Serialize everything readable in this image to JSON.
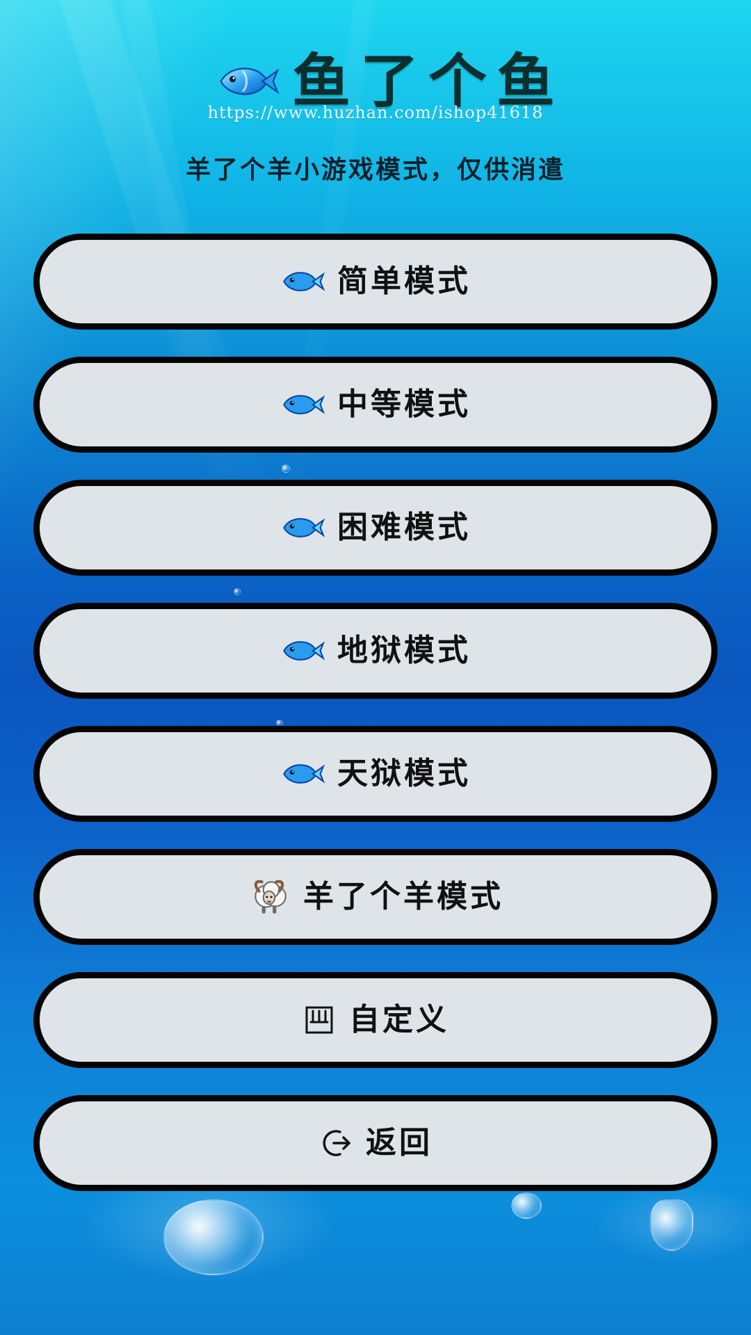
{
  "app": {
    "title": "鱼了个鱼",
    "watermark": "https://www.huzhan.com/ishop41618",
    "subtitle": "羊了个羊小游戏模式，仅供消遣"
  },
  "menu": {
    "items": [
      {
        "label": "简单模式",
        "icon": "fish-icon"
      },
      {
        "label": "中等模式",
        "icon": "fish-icon"
      },
      {
        "label": "困难模式",
        "icon": "fish-icon"
      },
      {
        "label": "地狱模式",
        "icon": "fish-icon"
      },
      {
        "label": "天狱模式",
        "icon": "fish-icon"
      },
      {
        "label": "羊了个羊模式",
        "icon": "ram-icon"
      },
      {
        "label": "自定义",
        "icon": "custom-icon"
      },
      {
        "label": "返回",
        "icon": "back-icon"
      }
    ]
  },
  "colors": {
    "button_bg": "#dfe4e8",
    "button_border": "#050505",
    "title_text": "#0a2f2e",
    "subtitle_text": "#0b1f2a",
    "background_top": "#1ed6ef",
    "background_mid": "#0b63c6"
  }
}
